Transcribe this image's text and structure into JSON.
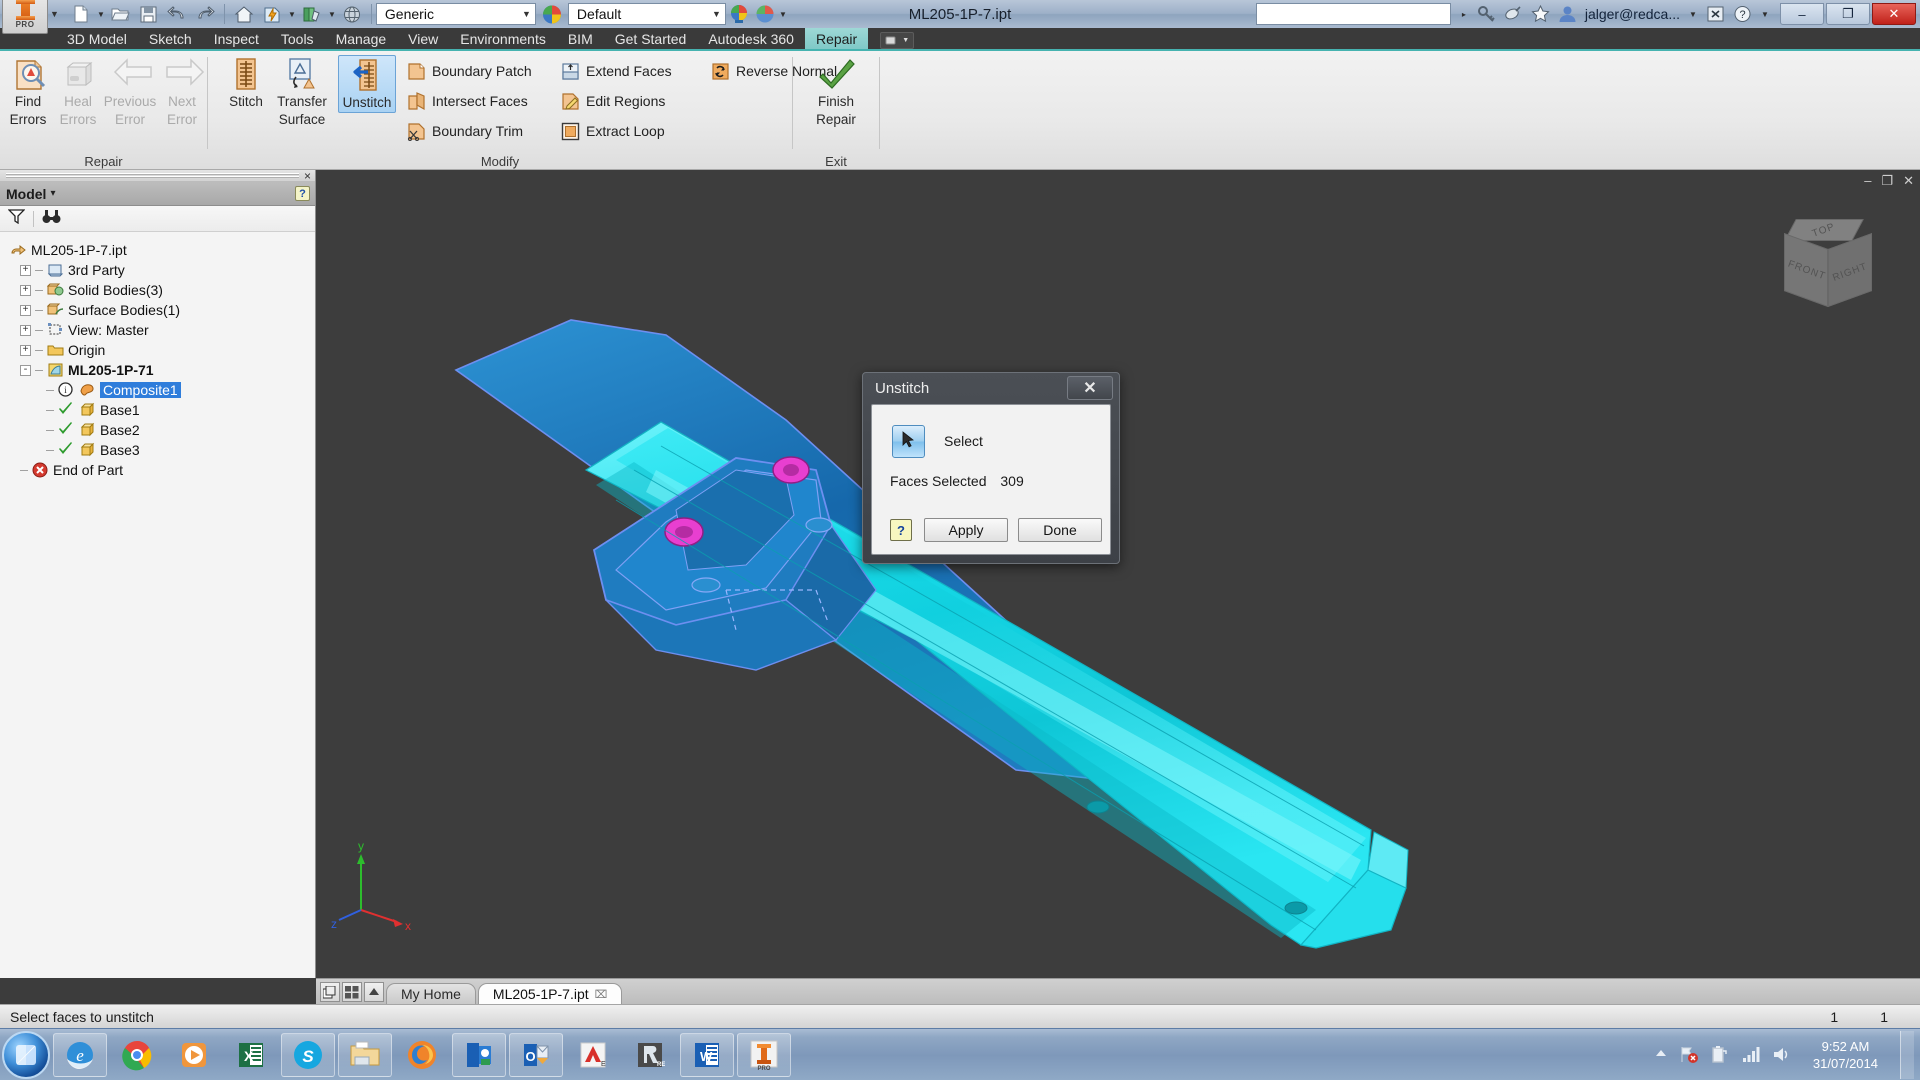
{
  "titlebar": {
    "document_title": "ML205-1P-7.ipt",
    "app_icon": "inventor-pro-icon",
    "pro_badge": "PRO",
    "qat": [
      {
        "name": "new-file-icon",
        "label": "New"
      },
      {
        "name": "open-file-icon",
        "label": "Open"
      },
      {
        "name": "save-icon",
        "label": "Save"
      },
      {
        "name": "undo-icon",
        "label": "Undo"
      },
      {
        "name": "redo-icon",
        "label": "Redo"
      },
      {
        "name": "home-icon",
        "label": "Home"
      },
      {
        "name": "update-icon",
        "label": "Update"
      },
      {
        "name": "material-library-icon",
        "label": "Material Library"
      },
      {
        "name": "appearance-globe-icon",
        "label": "Appearance"
      }
    ],
    "material_combo": {
      "value": "Generic",
      "placeholder": "Material"
    },
    "appearance_combo": {
      "value": "Default",
      "placeholder": "Appearance"
    },
    "search": {
      "value": "",
      "placeholder": ""
    },
    "user": "jalger@redca...",
    "right_icons": [
      "key-icon",
      "satellite-dish-icon",
      "star-icon",
      "user-icon",
      "close-x-icon",
      "help-icon"
    ],
    "window_buttons": {
      "minimize": "–",
      "maximize": "❐",
      "close": "✕"
    }
  },
  "ribbon": {
    "tabs": [
      {
        "label": "3D Model",
        "active": false
      },
      {
        "label": "Sketch",
        "active": false
      },
      {
        "label": "Inspect",
        "active": false
      },
      {
        "label": "Tools",
        "active": false
      },
      {
        "label": "Manage",
        "active": false
      },
      {
        "label": "View",
        "active": false
      },
      {
        "label": "Environments",
        "active": false
      },
      {
        "label": "BIM",
        "active": false
      },
      {
        "label": "Get Started",
        "active": false
      },
      {
        "label": "Autodesk 360",
        "active": false
      },
      {
        "label": "Repair",
        "active": true
      }
    ],
    "panels": [
      {
        "name": "Repair",
        "title": "Repair",
        "buttons": [
          {
            "label_line1": "Find",
            "label_line2": "Errors",
            "icon": "find-errors-icon",
            "disabled": false
          },
          {
            "label_line1": "Heal",
            "label_line2": "Errors",
            "icon": "heal-errors-icon",
            "disabled": true
          },
          {
            "label_line1": "Previous",
            "label_line2": "Error",
            "icon": "previous-error-icon",
            "disabled": true
          },
          {
            "label_line1": "Next",
            "label_line2": "Error",
            "icon": "next-error-icon",
            "disabled": true
          }
        ]
      },
      {
        "name": "Modify",
        "title": "Modify",
        "buttons": [
          {
            "label_line1": "Stitch",
            "label_line2": "",
            "icon": "stitch-icon",
            "disabled": false,
            "active": false
          },
          {
            "label_line1": "Transfer",
            "label_line2": "Surface",
            "icon": "transfer-surface-icon",
            "disabled": false,
            "active": false
          },
          {
            "label_line1": "Unstitch",
            "label_line2": "",
            "icon": "unstitch-icon",
            "disabled": false,
            "active": true
          }
        ],
        "small_items": [
          {
            "label": "Boundary Patch",
            "icon": "boundary-patch-icon"
          },
          {
            "label": "Intersect Faces",
            "icon": "intersect-faces-icon"
          },
          {
            "label": "Boundary Trim",
            "icon": "boundary-trim-icon"
          },
          {
            "label": "Extend Faces",
            "icon": "extend-faces-icon"
          },
          {
            "label": "Edit Regions",
            "icon": "edit-regions-icon"
          },
          {
            "label": "Extract Loop",
            "icon": "extract-loop-icon"
          },
          {
            "label": "Reverse Normal",
            "icon": "reverse-normal-icon"
          }
        ]
      },
      {
        "name": "Exit",
        "title": "Exit",
        "buttons": [
          {
            "label_line1": "Finish",
            "label_line2": "Repair",
            "icon": "green-check-icon",
            "disabled": false
          }
        ]
      }
    ]
  },
  "browser": {
    "title": "Model",
    "dropdown_caret": "▾",
    "help_label": "?",
    "close_label": "×",
    "toolbar_icons": [
      "filter-icon",
      "find-binoculars-icon"
    ],
    "tree": [
      {
        "label": "ML205-1P-7.ipt",
        "icon": "part-document-icon",
        "indent": 0,
        "expander": "",
        "selected": false,
        "bold": false
      },
      {
        "label": "3rd Party",
        "icon": "third-party-icon",
        "indent": 1,
        "expander": "+",
        "selected": false,
        "bold": false
      },
      {
        "label": "Solid Bodies(3)",
        "icon": "solid-bodies-icon",
        "indent": 1,
        "expander": "+",
        "selected": false,
        "bold": false
      },
      {
        "label": "Surface Bodies(1)",
        "icon": "surface-bodies-icon",
        "indent": 1,
        "expander": "+",
        "selected": false,
        "bold": false
      },
      {
        "label": "View: Master",
        "icon": "view-master-icon",
        "indent": 1,
        "expander": "+",
        "selected": false,
        "bold": false
      },
      {
        "label": "Origin",
        "icon": "origin-folder-icon",
        "indent": 1,
        "expander": "+",
        "selected": false,
        "bold": false
      },
      {
        "label": "ML205-1P-71",
        "icon": "composite-feature-icon",
        "indent": 1,
        "expander": "-",
        "selected": false,
        "bold": true
      },
      {
        "label": "Composite1",
        "icon": "composite1-icon",
        "indent": 2,
        "expander": "",
        "selected": true,
        "bold": false
      },
      {
        "label": "Base1",
        "icon": "base-body-icon",
        "indent": 2,
        "expander": "",
        "selected": false,
        "bold": false
      },
      {
        "label": "Base2",
        "icon": "base-body-icon",
        "indent": 2,
        "expander": "",
        "selected": false,
        "bold": false
      },
      {
        "label": "Base3",
        "icon": "base-body-icon",
        "indent": 2,
        "expander": "",
        "selected": false,
        "bold": false
      },
      {
        "label": "End of Part",
        "icon": "end-of-part-icon",
        "indent": 0,
        "expander": "",
        "selected": false,
        "bold": false
      }
    ]
  },
  "dialog": {
    "title": "Unstitch",
    "close_label": "✕",
    "select_button_label": "Select",
    "select_button_icon": "select-cursor-icon",
    "faces_selected_label": "Faces Selected",
    "faces_selected_count": "309",
    "help_label": "?",
    "apply_label": "Apply",
    "done_label": "Done"
  },
  "viewport": {
    "viewcube": {
      "top": "TOP",
      "front": "FRONT",
      "right": "RIGHT"
    },
    "axis_labels": {
      "x": "x",
      "y": "y",
      "z": "z"
    },
    "window_buttons": {
      "minimize": "–",
      "restore": "❐",
      "close": "✕"
    },
    "part_colors": {
      "surface": "#16dbe8",
      "selected_body": "#1a7fc4",
      "highlight": "#e63fd2",
      "edge": "#5a7fe8"
    }
  },
  "doctabs": {
    "left_icons": [
      "tile-windows-icon",
      "arrange-icon",
      "scroll-up-icon"
    ],
    "tabs": [
      {
        "label": "My Home",
        "active": false,
        "closable": false
      },
      {
        "label": "ML205-1P-7.ipt",
        "active": true,
        "closable": true,
        "close_glyph": "⌧"
      }
    ]
  },
  "statusbar": {
    "message": "Select faces to unstitch",
    "right_values": [
      "1",
      "1"
    ]
  },
  "taskbar": {
    "start_label": "Start",
    "items": [
      {
        "name": "internet-explorer-icon",
        "label": "Internet Explorer"
      },
      {
        "name": "google-chrome-icon",
        "label": "Google Chrome"
      },
      {
        "name": "media-player-icon",
        "label": "Windows Media Player"
      },
      {
        "name": "excel-icon",
        "label": "Microsoft Excel"
      },
      {
        "name": "skype-icon",
        "label": "Skype"
      },
      {
        "name": "file-explorer-icon",
        "label": "Windows Explorer"
      },
      {
        "name": "firefox-icon",
        "label": "Mozilla Firefox"
      },
      {
        "name": "lync-icon",
        "label": "Lync"
      },
      {
        "name": "outlook-icon",
        "label": "Microsoft Outlook"
      },
      {
        "name": "autocad-icon",
        "label": "AutoCAD"
      },
      {
        "name": "revit-icon",
        "label": "Revit"
      },
      {
        "name": "word-icon",
        "label": "Microsoft Word"
      },
      {
        "name": "inventor-icon",
        "label": "Autodesk Inventor"
      }
    ],
    "tray_icons": [
      "show-hidden-icons-icon",
      "network-error-icon",
      "battery-icon",
      "signal-icon",
      "volume-icon"
    ],
    "clock": {
      "time": "9:52 AM",
      "date": "31/07/2014"
    }
  }
}
